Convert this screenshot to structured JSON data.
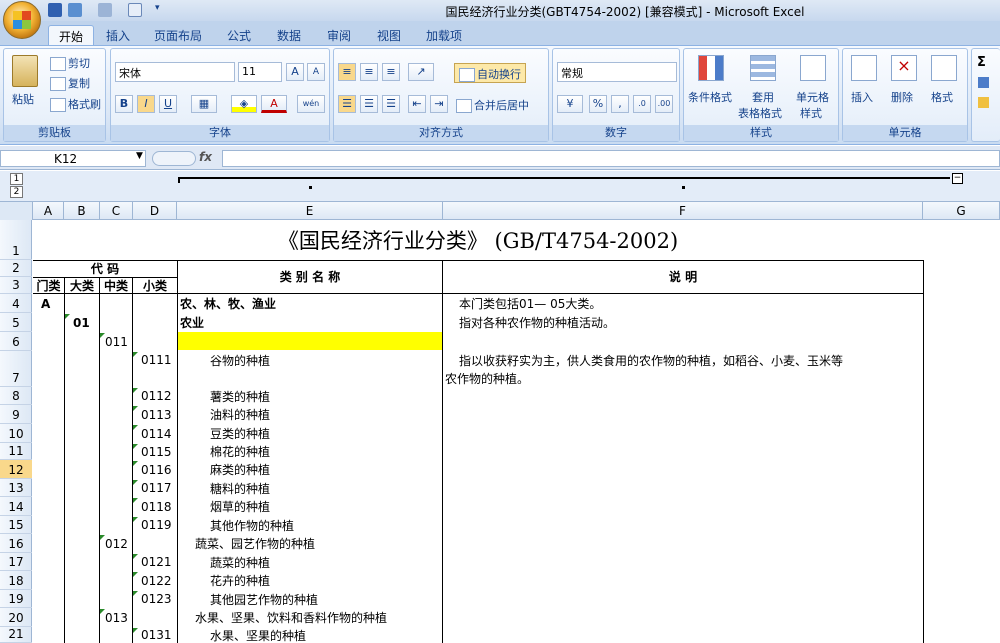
{
  "window_title": "国民经济行业分类(GBT4754-2002)  [兼容模式] - Microsoft Excel",
  "tabs": [
    "开始",
    "插入",
    "页面布局",
    "公式",
    "数据",
    "审阅",
    "视图",
    "加载项"
  ],
  "ribbon": {
    "clipboard": {
      "paste": "粘贴",
      "cut": "剪切",
      "copy": "复制",
      "format_painter": "格式刷",
      "label": "剪贴板"
    },
    "font": {
      "name": "宋体",
      "size": "11",
      "label": "字体",
      "bold": "B",
      "italic": "I",
      "underline": "U",
      "wen": "wén",
      "a_color": "A"
    },
    "alignment": {
      "wrap": "自动换行",
      "merge": "合并后居中",
      "label": "对齐方式"
    },
    "number": {
      "format": "常规",
      "percent": "%",
      "comma": ",",
      "label": "数字"
    },
    "styles": {
      "conditional": "条件格式",
      "table1": "套用",
      "table2": "表格格式",
      "cell1": "单元格",
      "cell2": "样式",
      "label": "样式"
    },
    "cells": {
      "insert": "插入",
      "delete": "删除",
      "format": "格式",
      "label": "单元格"
    },
    "editing": {
      "sigma": "Σ"
    }
  },
  "name_box": "K12",
  "fx": "fx",
  "outline_levels": [
    "1",
    "2"
  ],
  "columns": [
    "A",
    "B",
    "C",
    "D",
    "E",
    "F",
    "G"
  ],
  "rows": [
    "1",
    "2",
    "3",
    "4",
    "5",
    "6",
    "7",
    "8",
    "9",
    "10",
    "11",
    "12",
    "13",
    "14",
    "15",
    "16",
    "17",
    "18",
    "19",
    "20",
    "21"
  ],
  "selected_row": "12",
  "highlight_color": "#ffff00",
  "sheet": {
    "title": "《国民经济行业分类》 (GB/T4754-2002)",
    "code_header": "代    码",
    "name_header": "类 别 名 称",
    "desc_header": "说          明",
    "sub_headers": [
      "门类",
      "大类",
      "中类",
      "小类"
    ],
    "r4": {
      "a": "A",
      "e": "农、林、牧、渔业",
      "f": "本门类包括01— 05大类。"
    },
    "r5": {
      "b": "01",
      "e": "农业",
      "f": "指对各种农作物的种植活动。"
    },
    "r6": {
      "c": "011"
    },
    "r7": {
      "d": "0111",
      "e": "谷物的种植",
      "f1": "指以收获籽实为主，供人类食用的农作物的种植，如稻谷、小麦、玉米等",
      "f2": "农作物的种植。"
    },
    "r8": {
      "d": "0112",
      "e": "薯类的种植"
    },
    "r9": {
      "d": "0113",
      "e": "油料的种植"
    },
    "r10": {
      "d": "0114",
      "e": "豆类的种植"
    },
    "r11": {
      "d": "0115",
      "e": "棉花的种植"
    },
    "r12": {
      "d": "0116",
      "e": "麻类的种植"
    },
    "r13": {
      "d": "0117",
      "e": "糖料的种植"
    },
    "r14": {
      "d": "0118",
      "e": "烟草的种植"
    },
    "r15": {
      "d": "0119",
      "e": "其他作物的种植"
    },
    "r16": {
      "c": "012",
      "e": "蔬菜、园艺作物的种植"
    },
    "r17": {
      "d": "0121",
      "e": "蔬菜的种植"
    },
    "r18": {
      "d": "0122",
      "e": "花卉的种植"
    },
    "r19": {
      "d": "0123",
      "e": "其他园艺作物的种植"
    },
    "r20": {
      "c": "013",
      "e": "水果、坚果、饮料和香料作物的种植"
    },
    "r21": {
      "d": "0131",
      "e": "水果、坚果的种植"
    }
  }
}
